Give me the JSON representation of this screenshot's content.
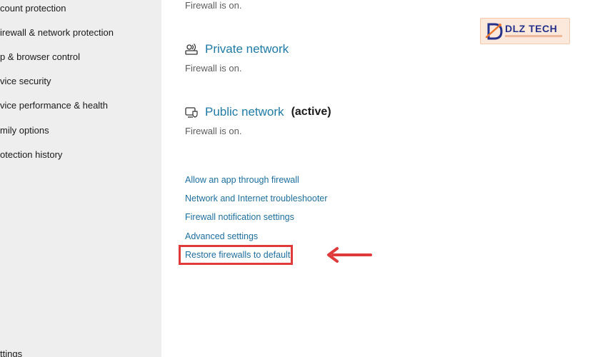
{
  "sidebar": {
    "items": [
      {
        "label": "count protection"
      },
      {
        "label": "irewall & network protection"
      },
      {
        "label": "p & browser control"
      },
      {
        "label": "vice security"
      },
      {
        "label": "vice performance & health"
      },
      {
        "label": "mily options"
      },
      {
        "label": "otection history"
      },
      {
        "label": "ttings"
      }
    ]
  },
  "main": {
    "top_status": "Firewall is on.",
    "private_network": {
      "label": "Private network",
      "icon": "private-network-icon",
      "status": "Firewall is on."
    },
    "public_network": {
      "label": "Public network",
      "active_label": "(active)",
      "icon": "public-network-icon",
      "status": "Firewall is on."
    },
    "links": [
      {
        "label": "Allow an app through firewall"
      },
      {
        "label": "Network and Internet troubleshooter"
      },
      {
        "label": "Firewall notification settings"
      },
      {
        "label": "Advanced settings"
      },
      {
        "label": "Restore firewalls to default"
      }
    ]
  },
  "annotation": {
    "highlight_color": "#e03a3a"
  },
  "logo": {
    "text": "DLZ TECH",
    "icon": "dlz-tech-logo-icon"
  },
  "colors": {
    "link": "#1e7aa6",
    "sidebar_bg": "#eeeeee",
    "logo_bg": "#fce9dc",
    "logo_text": "#25318b"
  }
}
